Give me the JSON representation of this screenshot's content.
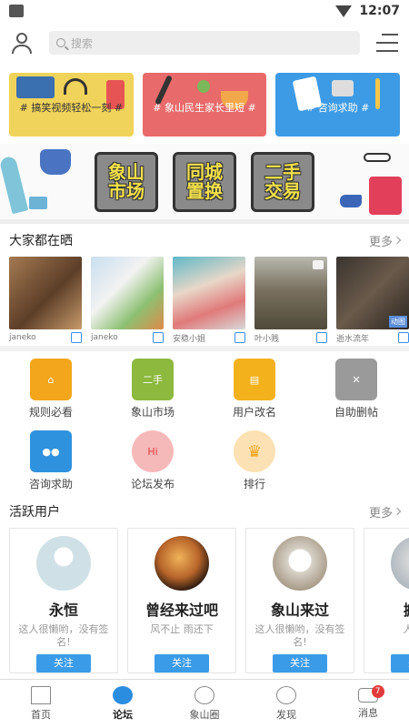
{
  "status": {
    "time": "12:07"
  },
  "search": {
    "placeholder": "搜索"
  },
  "banners": [
    {
      "label": "# 搞笑视频轻松一刻 #",
      "color": "#f0d35a"
    },
    {
      "label": "# 象山民生家长里短 #",
      "color": "#e86a6a"
    },
    {
      "label": "# 咨询求助 #",
      "color": "#3d9be5"
    }
  ],
  "market_strip": {
    "stickers": [
      "象山\n市场",
      "同城\n置换",
      "二手\n交易"
    ]
  },
  "showcase": {
    "title": "大家都在晒",
    "more": "更多",
    "items": [
      {
        "author": "janeko"
      },
      {
        "author": "janeko"
      },
      {
        "author": "安稳小姐"
      },
      {
        "author": "叶小贱"
      },
      {
        "author": "逝水流年",
        "badge": "动图"
      }
    ]
  },
  "shortcuts": [
    {
      "label": "规则必看",
      "icon": "rules-house-icon",
      "color": "#f3a51b"
    },
    {
      "label": "象山市场",
      "icon": "second-hand-market-icon",
      "color": "#8cb93e"
    },
    {
      "label": "用户改名",
      "icon": "id-card-icon",
      "color": "#f3b21b"
    },
    {
      "label": "自助删帖",
      "icon": "delete-post-icon",
      "color": "#9a9a9a"
    },
    {
      "label": "咨询求助",
      "icon": "users-help-icon",
      "color": "#2f92de"
    },
    {
      "label": "论坛发布",
      "icon": "hi-bubble-icon",
      "color": "#f6b9b9"
    },
    {
      "label": "排行",
      "icon": "crown-icon",
      "color": "#fbe1b3"
    }
  ],
  "active_users": {
    "title": "活跃用户",
    "more": "更多",
    "users": [
      {
        "name": "永恒",
        "sign": "这人很懒哟，没有签名!",
        "follow": "关注"
      },
      {
        "name": "曾经来过吧",
        "sign": "风不止 雨还下",
        "follow": "关注"
      },
      {
        "name": "象山来过",
        "sign": "这人很懒哟，没有签名!",
        "follow": "关注"
      },
      {
        "name": "搬砖",
        "sign": "人的一",
        "follow": "关注"
      }
    ]
  },
  "tabbar": [
    {
      "label": "首页",
      "icon": "home-icon"
    },
    {
      "label": "论坛",
      "icon": "forum-icon",
      "active": true
    },
    {
      "label": "象山圈",
      "icon": "circle-icon"
    },
    {
      "label": "发现",
      "icon": "discover-icon"
    },
    {
      "label": "消息",
      "icon": "message-icon",
      "badge": "7"
    }
  ]
}
